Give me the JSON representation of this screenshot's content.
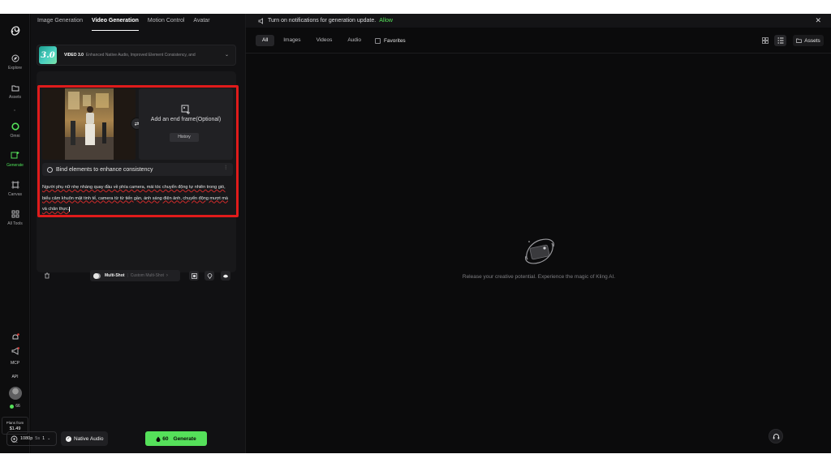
{
  "sidebar": {
    "items": [
      {
        "label": "Explore",
        "icon": "compass-icon"
      },
      {
        "label": "Assets",
        "icon": "folder-icon"
      },
      {
        "label": "Omni",
        "icon": "omni-ring-icon"
      },
      {
        "label": "Generate",
        "icon": "generate-icon",
        "active": true
      },
      {
        "label": "Canvas",
        "icon": "canvas-icon"
      },
      {
        "label": "All Tools",
        "icon": "grid-icon"
      }
    ],
    "bottom": {
      "mcp": "MCP",
      "api": "API",
      "credits": "66",
      "plans_label": "Plans from",
      "plans_price": "$1.49"
    }
  },
  "top_tabs": [
    "Image Generation",
    "Video Generation",
    "Motion Control",
    "Avatar"
  ],
  "active_tab": "Video Generation",
  "model": {
    "badge": "3.0",
    "name": "VIDEO 3.0",
    "description": "Enhanced Native Audio, Improved Element Consistency, and"
  },
  "frames": {
    "end_frame_label": "Add an end frame(Optional)",
    "history_label": "History"
  },
  "bind_elements": "Bind elements to enhance consistency",
  "prompt": "Người phụ nữ nhẹ nhàng quay đầu về phía camera, mái tóc chuyển động tự nhiên trong gió, biểu cảm khuôn mặt tinh tế, camera từ từ tiến gần, ánh sáng điện ảnh, chuyển động mượt mà và chân thực.",
  "multishot": {
    "label": "Multi-Shot",
    "custom_label": "Custom Multi-Shot",
    "chevron": "›"
  },
  "settings": {
    "resolution": "1080p",
    "duration": "5s",
    "count": "1"
  },
  "native_audio": "Native Audio",
  "generate": {
    "cost": "60",
    "label": "Generate"
  },
  "notification": {
    "text": "Turn on notifications for generation update.",
    "action": "Allow"
  },
  "filters": [
    "All",
    "Images",
    "Videos",
    "Audio"
  ],
  "favorites": "Favorites",
  "assets_button": "Assets",
  "empty_state": "Release your creative potential. Experience the magic of Kling AI.",
  "colors": {
    "accent": "#55e05a",
    "highlight": "#e01b1b",
    "background": "#0b0b0c"
  }
}
